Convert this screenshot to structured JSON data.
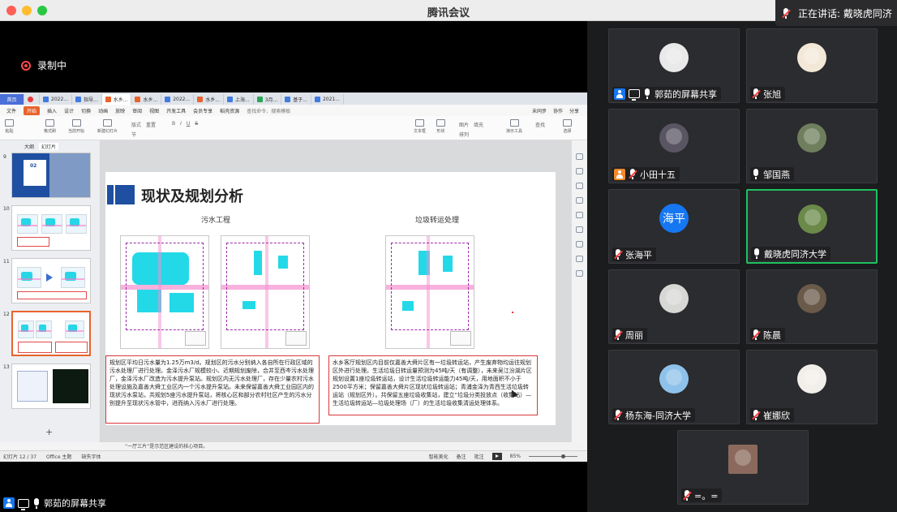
{
  "window": {
    "title": "腾讯会议",
    "speaking_prefix": "正在讲话: 戴晓虎同济"
  },
  "share": {
    "recording_label": "录制中",
    "sharer_label": "郭茹的屏幕共享"
  },
  "wps": {
    "tabs": [
      {
        "label": "首页",
        "icon": "home"
      },
      {
        "label": "",
        "icon": "wps-logo"
      },
      {
        "label": "2022...",
        "icon": "doc"
      },
      {
        "label": "指导...",
        "icon": "doc"
      },
      {
        "label": "水乡...",
        "icon": "ppt"
      },
      {
        "label": "水乡...",
        "icon": "ppt"
      },
      {
        "label": "2022...",
        "icon": "doc"
      },
      {
        "label": "水乡...",
        "icon": "ppt"
      },
      {
        "label": "上海...",
        "icon": "doc"
      },
      {
        "label": "3月...",
        "icon": "sheet"
      },
      {
        "label": "基于...",
        "icon": "doc"
      },
      {
        "label": "2021...",
        "icon": "doc"
      }
    ],
    "menu": [
      "文件",
      "开始",
      "插入",
      "设计",
      "切换",
      "动画",
      "放映",
      "审阅",
      "视图",
      "开发工具",
      "会员专享",
      "稻壳资源"
    ],
    "menu_active": "开始",
    "menu_search": "查找命令、搜索模板",
    "menu_right": [
      "未同步",
      "协作",
      "分享"
    ],
    "toolbar_groups": [
      "粘贴",
      "格式刷",
      "当前开始",
      "新建幻灯片",
      "版式",
      "节",
      "重置"
    ],
    "toolbar_right": [
      "图片",
      "填充",
      "查找",
      "文本框",
      "形状",
      "排列",
      "演示工具",
      "选择"
    ],
    "panel_tabs": [
      "大纲",
      "幻灯片"
    ],
    "panel_active": "幻灯片",
    "thumb_numbers": [
      "9",
      "10",
      "11",
      "12",
      "13"
    ],
    "cover_thumb_label": "02",
    "slide": {
      "title": "现状及规划分析",
      "left_heading": "污水工程",
      "right_heading": "垃圾转运处理",
      "left_text": "规划区平均日污水量为1.25万m3/d。规划区的污水分别纳入各自所在行政区域的污水处理厂进行处理。金泽污水厂规模较小、近期规划废除，合并至西岑污水处理厂，金泽污水厂改造为污水提升泵站。规划区内无污水处理厂，存在少量农村污水处理设施及嘉善大舜工业区内一个污水提升泵站。未来保留嘉善大舜工业园区内的现状污水泵站，共规划5座污水提升泵站，将核心区和部分农村社区产生的污水分别提升至现状污水管中，进而纳入污水厂进行处理。",
      "right_text": "水乡客厅规划区内目前仅嘉善大舜片区有一垃圾转运站，产生废弃物均运往规划区外进行处理。生活垃圾日转运量预测为45吨/天（有调整），未来吴江汾湖片区规划设置1座垃圾转运站，设计生活垃圾转运能力45吨/天，用地面积不小于2500平方米；保留嘉善大舜片区现状垃圾转运站；青浦金泽为青西生活垃圾转运站（规划区外）。共保留五座垃圾收集站，建立“垃圾分类投放点（收集站）—生活垃圾转运站—垃圾处理场（厂）的生活垃圾收集清运处理体系。"
    },
    "notes_text": "“一厅三片”是示范区建设的核心项目。",
    "status": {
      "slide_counter": "幻灯片 12 / 37",
      "theme": "Office 主题",
      "font_missing": "缺失字体",
      "beautify": "智能美化",
      "notes": "备注",
      "comments": "批注",
      "zoom": "85%"
    }
  },
  "participants": [
    {
      "name": "郭茹的屏幕共享",
      "icons": [
        "user-blue",
        "screen",
        "mic"
      ],
      "avatar": "sketch",
      "active": false
    },
    {
      "name": "张旭",
      "icons": [
        "mic-off"
      ],
      "avatar": "cartoon",
      "active": false
    },
    {
      "name": "小田十五",
      "icons": [
        "user-orange",
        "mic-off"
      ],
      "avatar": "dark",
      "active": false
    },
    {
      "name": "邹国燕",
      "icons": [
        "mic"
      ],
      "avatar": "photo",
      "active": false
    },
    {
      "name": "张海平",
      "icons": [
        "mic-off"
      ],
      "avatar": "text",
      "avatar_text": "海平",
      "active": false
    },
    {
      "name": "戴晓虎同济大学",
      "icons": [
        "mic"
      ],
      "avatar": "earth",
      "active": true
    },
    {
      "name": "周丽",
      "icons": [
        "mic-off"
      ],
      "avatar": "cat",
      "active": false
    },
    {
      "name": "陈晨",
      "icons": [
        "mic-off"
      ],
      "avatar": "portrait",
      "active": false
    },
    {
      "name": "杨东海-同济大学",
      "icons": [
        "mic-off"
      ],
      "avatar": "sky",
      "active": false
    },
    {
      "name": "崔娜欣",
      "icons": [
        "mic-off"
      ],
      "avatar": "white",
      "active": false
    },
    {
      "name": "=。=",
      "icons": [
        "mic-off"
      ],
      "avatar": "square",
      "active": false
    }
  ]
}
